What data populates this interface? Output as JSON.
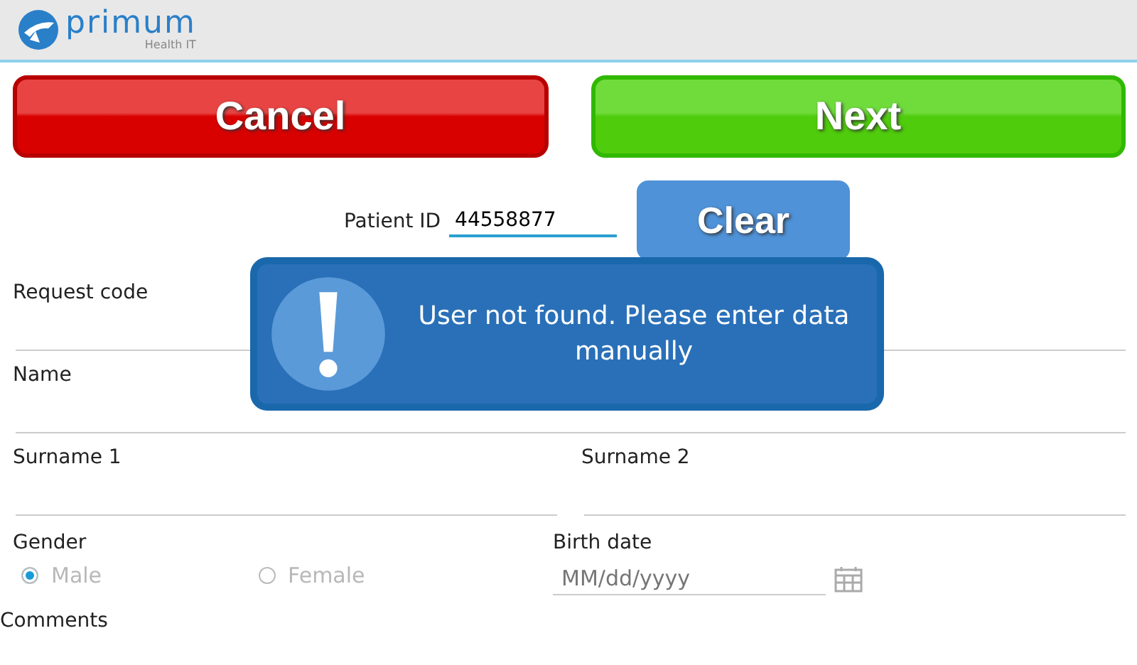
{
  "header": {
    "logo_text": "primum",
    "logo_subtext": "Health IT"
  },
  "actions": [
    {
      "label": "Cancel",
      "kind": "cancel"
    },
    {
      "label": "Next",
      "kind": "next"
    }
  ],
  "patient_id": {
    "label": "Patient ID",
    "value": "44558877",
    "clear_label": "Clear"
  },
  "fields": [
    {
      "label": "Request code"
    },
    {
      "label": "Name"
    }
  ],
  "surnames": [
    {
      "label": "Surname 1"
    },
    {
      "label": "Surname 2"
    }
  ],
  "gender": {
    "label": "Gender",
    "options": [
      {
        "label": "Male",
        "selected": true,
        "disabled": true
      },
      {
        "label": "Female",
        "selected": false,
        "disabled": true
      }
    ]
  },
  "birth_date": {
    "label": "Birth date",
    "placeholder": "MM/dd/yyyy"
  },
  "comments": {
    "label": "Comments"
  },
  "toast": {
    "message": "User not found. Please enter data manually"
  }
}
